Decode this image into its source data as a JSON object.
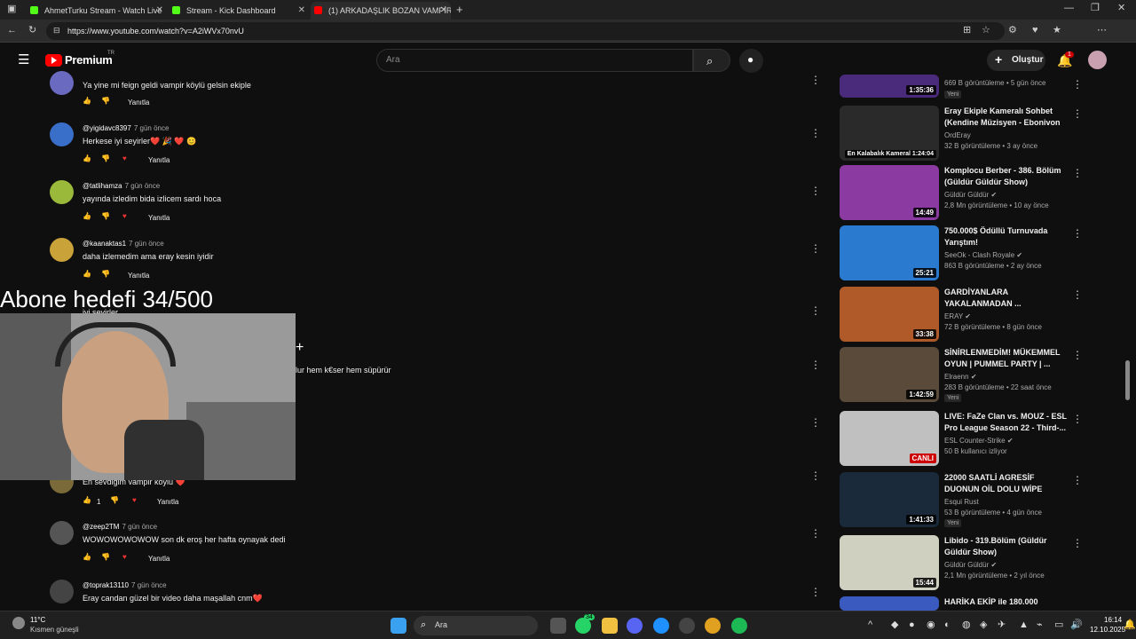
{
  "browser": {
    "tabs": [
      {
        "label": "AhmetTurku Stream - Watch Live",
        "color": "#53fc18"
      },
      {
        "label": "Stream - Kick Dashboard",
        "color": "#53fc18"
      },
      {
        "label": "(1) ARKADAŞLIK BOZAN VAMPİR",
        "color": "#ff0000"
      }
    ],
    "url": "https://www.youtube.com/watch?v=A2iWVx70nvU",
    "new_tab": "+"
  },
  "youtube": {
    "logo": "Premium",
    "logo_region": "TR",
    "search_placeholder": "Ara",
    "create_label": "Oluştur",
    "notif_count": "1"
  },
  "comments": [
    {
      "author": "",
      "time": "",
      "text": "Ya yine mi feign geldi vampir köylü gelsin ekiple",
      "likes": "",
      "reply": "Yanıtla",
      "heart": false,
      "avatar_color": "#6a6ac0"
    },
    {
      "author": "@yigidavc8397",
      "time": "7 gün önce",
      "text": "Herkese iyi seyirler❤️ 🎉 ❤️ 😊",
      "likes": "",
      "reply": "Yanıtla",
      "heart": true,
      "avatar_color": "#3a6fc9"
    },
    {
      "author": "@tatlihamza",
      "time": "7 gün önce",
      "text": "yayında izledim bida izlicem sardı hoca",
      "likes": "",
      "reply": "Yanıtla",
      "heart": true,
      "avatar_color": "#9ab83a"
    },
    {
      "author": "@kaanaktas1",
      "time": "7 gün önce",
      "text": "daha izlemedim ama eray kesin iyidir",
      "likes": "",
      "reply": "Yanıtla",
      "heart": false,
      "avatar_color": "#c9a23a"
    },
    {
      "author": "@zeep2TM",
      "time": "7 gün önce",
      "text": "WOWOWOWOWOW son dk eroş her hafta oynayak dedi",
      "likes": "",
      "reply": "Yanıtla",
      "heart": true,
      "avatar_color": "#555555"
    },
    {
      "author": "@toprak13110",
      "time": "7 gün önce",
      "text": "Eray candan güzel bir video daha maşallah cnm❤️",
      "likes": "",
      "reply": "Yanıtla",
      "heart": false,
      "avatar_color": "#444444"
    }
  ],
  "partial_comments": {
    "hidden_text": "iyi seyirler",
    "side_text": "lur hem k€ser hem süpürür",
    "vampir_text": "En sevdiğim vampir köylü ❤️",
    "vampir_likes": "1",
    "vampir_reply": "Yanıtla"
  },
  "overlay": {
    "title": "Abone hedefi 34/500"
  },
  "videos": [
    {
      "title": "",
      "channel": "",
      "meta": "669 B görüntüleme • 5 gün önce",
      "duration": "1:35:36",
      "badge": "Yeni",
      "verified": false,
      "thumb": "#4a2a7a"
    },
    {
      "title": "Eray Ekiple Kameralı Sohbet (Kendine Müzisyen - Ebonivon ...",
      "channel": "OrdEray",
      "meta": "32 B görüntüleme • 3 ay önce",
      "duration": "En Kalabalık Kameral 1:24:04",
      "badge": "",
      "verified": false,
      "thumb": "#2a2a2a"
    },
    {
      "title": "Komplocu Berber - 386. Bölüm (Güldür Güldür Show)",
      "channel": "Güldür Güldür",
      "meta": "2,8 Mn görüntüleme • 10 ay önce",
      "duration": "14:49",
      "badge": "",
      "verified": true,
      "thumb": "#8a3aa0"
    },
    {
      "title": "750.000$ Ödüllü Turnuvada Yarıştım!",
      "channel": "SeeOk - Clash Royale",
      "meta": "863 B görüntüleme • 2 ay önce",
      "duration": "25:21",
      "badge": "",
      "verified": true,
      "thumb": "#2a7ad0"
    },
    {
      "title": "GARDİYANLARA YAKALANMADAN ...",
      "channel": "ERAY",
      "meta": "72 B görüntüleme • 8 gün önce",
      "duration": "33:38",
      "badge": "",
      "verified": true,
      "thumb": "#b05a2a"
    },
    {
      "title": "SİNİRLENMEDİM! MÜKEMMEL OYUN | PUMMEL PARTY | ...",
      "channel": "Elraenn",
      "meta": "283 B görüntüleme • 22 saat önce",
      "duration": "1:42:59",
      "badge": "Yeni",
      "verified": true,
      "thumb": "#5a4a3a"
    },
    {
      "title": "LIVE: FaZe Clan vs. MOUZ - ESL Pro League Season 22 - Third-...",
      "channel": "ESL Counter-Strike",
      "meta": "50 B kullanıcı izliyor",
      "duration": "CANLI",
      "badge": "",
      "verified": true,
      "thumb": "#c0c0c0"
    },
    {
      "title": "22000 SAATLİ AGRESİF DUONUN OİL DOLU WİPE GÜN...",
      "channel": "Esqui Rust",
      "meta": "53 B görüntüleme • 4 gün önce",
      "duration": "1:41:33",
      "badge": "Yeni",
      "verified": false,
      "thumb": "#1a2a3a"
    },
    {
      "title": "Libido - 319.Bölüm (Güldür Güldür Show)",
      "channel": "Güldür Güldür",
      "meta": "2,1 Mn görüntüleme • 2 yıl önce",
      "duration": "15:44",
      "badge": "",
      "verified": true,
      "thumb": "#d0d0c0"
    },
    {
      "title": "HARİKA EKİP ile 180.000",
      "channel": "",
      "meta": "",
      "duration": "",
      "badge": "",
      "verified": false,
      "thumb": "#3a5ac0"
    }
  ],
  "taskbar": {
    "temp": "11°C",
    "weather": "Kısmen güneşli",
    "search": "Ara",
    "time": "16:14",
    "date": "12.10.2025",
    "whatsapp_badge": "34"
  }
}
